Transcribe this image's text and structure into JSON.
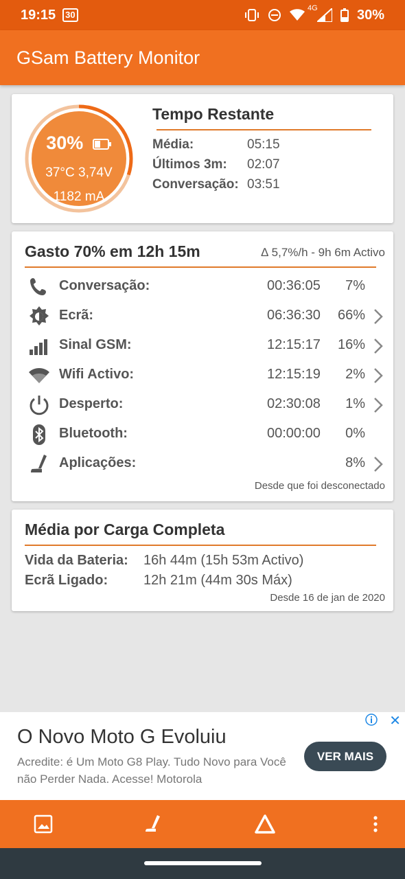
{
  "status_bar": {
    "time": "19:15",
    "calendar_day": "30",
    "network": "4G",
    "battery": "30%"
  },
  "app": {
    "title": "GSam Battery Monitor"
  },
  "gauge": {
    "percent": "30%",
    "level": 0.3,
    "temp_voltage": "37°C  3,74V",
    "current": "1182 mA"
  },
  "tempo": {
    "title": "Tempo Restante",
    "rows": [
      {
        "label": "Média:",
        "value": "05:15"
      },
      {
        "label": "Últimos 3m:",
        "value": "02:07"
      },
      {
        "label": "Conversação:",
        "value": "03:51"
      }
    ]
  },
  "usage": {
    "title": "Gasto 70% em 12h 15m",
    "rate": "∆ 5,7%/h - 9h 6m Activo",
    "rows": [
      {
        "icon": "phone-icon",
        "label": "Conversação:",
        "time": "00:36:05",
        "percent": "7%"
      },
      {
        "icon": "brightness-icon",
        "label": "Ecrã:",
        "time": "06:36:30",
        "percent": "66%"
      },
      {
        "icon": "signal-icon",
        "label": "Sinal GSM:",
        "time": "12:15:17",
        "percent": "16%"
      },
      {
        "icon": "wifi-icon",
        "label": "Wifi Activo:",
        "time": "12:15:19",
        "percent": "2%"
      },
      {
        "icon": "power-icon",
        "label": "Desperto:",
        "time": "02:30:08",
        "percent": "1%"
      },
      {
        "icon": "bluetooth-icon",
        "label": "Bluetooth:",
        "time": "00:00:00",
        "percent": "0%"
      },
      {
        "icon": "apps-icon",
        "label": "Aplicações:",
        "time": "",
        "percent": "8%"
      }
    ],
    "footer": "Desde que foi desconectado"
  },
  "full_charge": {
    "title": "Média por Carga Completa",
    "rows": [
      {
        "label": "Vida da Bateria:",
        "value": "16h 44m (15h 53m Activo)"
      },
      {
        "label": "Ecrã Ligado:",
        "value": "12h 21m (44m 30s Máx)"
      }
    ],
    "footer": "Desde 16 de jan de 2020"
  },
  "ad": {
    "title": "O Novo Moto G Evoluiu",
    "body": "Acredite: é Um Moto G8 Play. Tudo Novo para Você não Perder Nada. Acesse! Motorola",
    "button": "VER MAIS"
  },
  "colors": {
    "status_bar": "#e35b0e",
    "app_bar": "#f07020",
    "gauge_fill": "#f08a3a",
    "accent_line": "#e07a2a",
    "ad_button": "#3a4a55"
  }
}
